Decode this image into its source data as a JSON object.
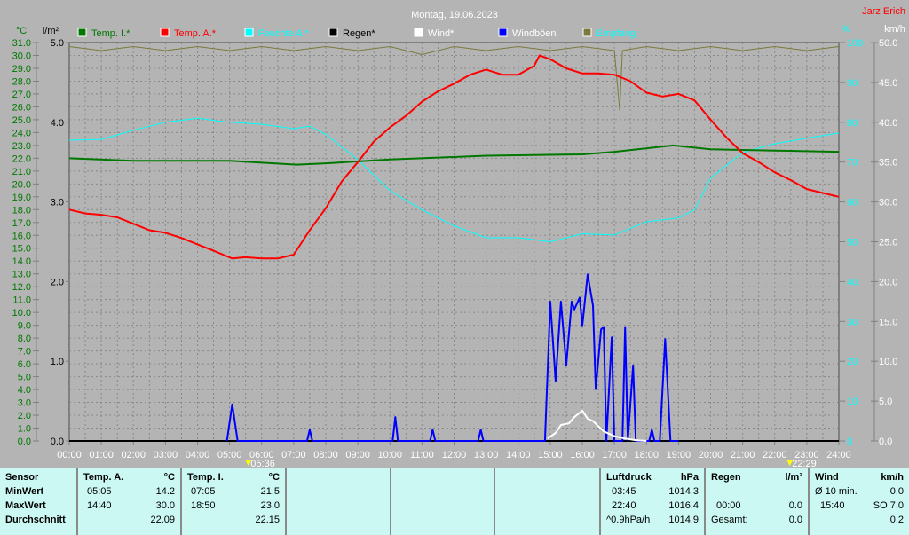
{
  "title": "Montag, 19.06.2023",
  "author": "Jarz Erich",
  "colors": {
    "temp_i": "#007800",
    "temp_a": "#ff0000",
    "humidity": "#00ffff",
    "rain": "#000000",
    "wind": "#ffffff",
    "gusts": "#0000ff",
    "reception": "#7a7a3c"
  },
  "chart_data": {
    "type": "line",
    "title": "Montag, 19.06.2023",
    "axes": {
      "temp": {
        "unit": "°C",
        "range": [
          0,
          31
        ],
        "ticks": [
          "0.0",
          "1.0",
          "2.0",
          "3.0",
          "4.0",
          "5.0",
          "6.0",
          "7.0",
          "8.0",
          "9.0",
          "10.0",
          "11.0",
          "12.0",
          "13.0",
          "14.0",
          "15.0",
          "16.0",
          "17.0",
          "18.0",
          "19.0",
          "20.0",
          "21.0",
          "22.0",
          "23.0",
          "24.0",
          "25.0",
          "26.0",
          "27.0",
          "28.0",
          "29.0",
          "30.0",
          "31.0"
        ]
      },
      "rain": {
        "unit": "l/m²",
        "range": [
          0,
          5
        ],
        "ticks": [
          "0.0",
          "1.0",
          "2.0",
          "3.0",
          "4.0",
          "5.0"
        ]
      },
      "humidity": {
        "unit": "%",
        "range": [
          0,
          100
        ],
        "ticks": [
          "0",
          "10",
          "20",
          "30",
          "40",
          "50",
          "60",
          "70",
          "80",
          "90",
          "100"
        ]
      },
      "wind": {
        "unit": "km/h",
        "range": [
          0,
          50
        ],
        "ticks": [
          "0.0",
          "5.0",
          "10.0",
          "15.0",
          "20.0",
          "25.0",
          "30.0",
          "35.0",
          "40.0",
          "45.0",
          "50.0"
        ]
      },
      "x": {
        "range": [
          "00:00",
          "24:00"
        ],
        "ticks": [
          "00:00",
          "01:00",
          "02:00",
          "03:00",
          "04:00",
          "05:00",
          "06:00",
          "07:00",
          "08:00",
          "09:00",
          "10:00",
          "11:00",
          "12:00",
          "13:00",
          "14:00",
          "15:00",
          "16:00",
          "17:00",
          "18:00",
          "19:00",
          "20:00",
          "21:00",
          "22:00",
          "23:00",
          "24:00"
        ]
      }
    },
    "grid": true,
    "legend_position": "top",
    "legend": [
      {
        "key": "temp_i",
        "label": "Temp. I.*"
      },
      {
        "key": "temp_a",
        "label": "Temp. A.*"
      },
      {
        "key": "humidity",
        "label": "Feuchte A.*"
      },
      {
        "key": "rain",
        "label": "Regen*"
      },
      {
        "key": "wind",
        "label": "Wind*"
      },
      {
        "key": "gusts",
        "label": "Windböen"
      },
      {
        "key": "reception",
        "label": "Empfang"
      }
    ],
    "sun_markers": [
      "05:36",
      "22:29"
    ],
    "series": [
      {
        "key": "temp_a",
        "axis": "temp",
        "points": [
          [
            "00:00",
            18.0
          ],
          [
            "00:30",
            17.7
          ],
          [
            "01:00",
            17.6
          ],
          [
            "01:30",
            17.4
          ],
          [
            "02:00",
            16.9
          ],
          [
            "02:30",
            16.4
          ],
          [
            "03:00",
            16.2
          ],
          [
            "03:30",
            15.8
          ],
          [
            "04:00",
            15.3
          ],
          [
            "04:30",
            14.8
          ],
          [
            "05:05",
            14.2
          ],
          [
            "05:30",
            14.3
          ],
          [
            "06:00",
            14.2
          ],
          [
            "06:30",
            14.2
          ],
          [
            "07:00",
            14.5
          ],
          [
            "07:30",
            16.4
          ],
          [
            "08:00",
            18.1
          ],
          [
            "08:30",
            20.2
          ],
          [
            "09:00",
            21.7
          ],
          [
            "09:30",
            23.3
          ],
          [
            "10:00",
            24.4
          ],
          [
            "10:30",
            25.3
          ],
          [
            "11:00",
            26.4
          ],
          [
            "11:30",
            27.2
          ],
          [
            "12:00",
            27.8
          ],
          [
            "12:30",
            28.5
          ],
          [
            "13:00",
            28.9
          ],
          [
            "13:30",
            28.5
          ],
          [
            "14:00",
            28.5
          ],
          [
            "14:30",
            29.2
          ],
          [
            "14:40",
            30.0
          ],
          [
            "15:00",
            29.7
          ],
          [
            "15:30",
            29.0
          ],
          [
            "16:00",
            28.6
          ],
          [
            "16:30",
            28.6
          ],
          [
            "17:00",
            28.5
          ],
          [
            "17:30",
            28.0
          ],
          [
            "18:00",
            27.1
          ],
          [
            "18:30",
            26.8
          ],
          [
            "19:00",
            27.0
          ],
          [
            "19:30",
            26.5
          ],
          [
            "20:00",
            25.0
          ],
          [
            "20:30",
            23.6
          ],
          [
            "21:00",
            22.4
          ],
          [
            "21:30",
            21.7
          ],
          [
            "22:00",
            20.9
          ],
          [
            "22:30",
            20.3
          ],
          [
            "23:00",
            19.6
          ],
          [
            "23:30",
            19.3
          ],
          [
            "24:00",
            19.0
          ]
        ]
      },
      {
        "key": "temp_i",
        "axis": "temp",
        "points": [
          [
            "00:00",
            22.0
          ],
          [
            "02:00",
            21.8
          ],
          [
            "05:00",
            21.8
          ],
          [
            "07:05",
            21.5
          ],
          [
            "08:00",
            21.6
          ],
          [
            "10:00",
            21.9
          ],
          [
            "13:00",
            22.2
          ],
          [
            "16:00",
            22.3
          ],
          [
            "17:00",
            22.5
          ],
          [
            "18:50",
            23.0
          ],
          [
            "20:00",
            22.7
          ],
          [
            "22:00",
            22.6
          ],
          [
            "24:00",
            22.5
          ]
        ]
      },
      {
        "key": "humidity",
        "axis": "humidity",
        "points": [
          [
            "00:00",
            75.5
          ],
          [
            "01:00",
            75.7
          ],
          [
            "02:00",
            78
          ],
          [
            "03:00",
            80
          ],
          [
            "04:00",
            81
          ],
          [
            "05:00",
            80
          ],
          [
            "06:00",
            79.5
          ],
          [
            "07:00",
            78.4
          ],
          [
            "07:30",
            79
          ],
          [
            "08:00",
            77
          ],
          [
            "09:00",
            70.6
          ],
          [
            "10:00",
            62.8
          ],
          [
            "11:00",
            58
          ],
          [
            "12:00",
            54
          ],
          [
            "13:00",
            51
          ],
          [
            "14:00",
            51
          ],
          [
            "15:00",
            50
          ],
          [
            "16:00",
            52
          ],
          [
            "17:00",
            51.7
          ],
          [
            "18:00",
            55
          ],
          [
            "19:00",
            56
          ],
          [
            "19:30",
            58
          ],
          [
            "20:00",
            66
          ],
          [
            "21:00",
            72.4
          ],
          [
            "22:00",
            74.6
          ],
          [
            "23:00",
            76
          ],
          [
            "24:00",
            77.3
          ]
        ]
      },
      {
        "key": "reception",
        "axis": "humidity",
        "points": [
          [
            "00:00",
            99
          ],
          [
            "01:00",
            98
          ],
          [
            "02:00",
            99
          ],
          [
            "03:00",
            98
          ],
          [
            "04:00",
            99
          ],
          [
            "05:00",
            98
          ],
          [
            "06:00",
            99
          ],
          [
            "07:00",
            98
          ],
          [
            "08:00",
            99
          ],
          [
            "09:00",
            98
          ],
          [
            "10:00",
            99
          ],
          [
            "11:00",
            97
          ],
          [
            "12:00",
            99
          ],
          [
            "13:00",
            98
          ],
          [
            "14:00",
            99
          ],
          [
            "15:00",
            98
          ],
          [
            "16:00",
            99
          ],
          [
            "17:00",
            98
          ],
          [
            "17:10",
            83
          ],
          [
            "17:15",
            98
          ],
          [
            "18:00",
            99
          ],
          [
            "19:00",
            98
          ],
          [
            "20:00",
            99
          ],
          [
            "21:00",
            98
          ],
          [
            "22:00",
            99
          ],
          [
            "23:00",
            98
          ],
          [
            "24:00",
            99
          ]
        ]
      },
      {
        "key": "rain",
        "axis": "rain",
        "points": [
          [
            "00:00",
            0
          ],
          [
            "24:00",
            0
          ]
        ]
      },
      {
        "key": "gusts",
        "axis": "wind",
        "points": [
          [
            "04:55",
            0
          ],
          [
            "05:05",
            4.6
          ],
          [
            "05:15",
            0
          ],
          [
            "07:25",
            0
          ],
          [
            "07:30",
            1.4
          ],
          [
            "07:35",
            0
          ],
          [
            "10:05",
            0
          ],
          [
            "10:10",
            3.0
          ],
          [
            "10:15",
            0
          ],
          [
            "11:15",
            0
          ],
          [
            "11:20",
            1.4
          ],
          [
            "11:25",
            0
          ],
          [
            "12:45",
            0
          ],
          [
            "12:50",
            1.4
          ],
          [
            "12:55",
            0
          ],
          [
            "14:50",
            0
          ],
          [
            "15:00",
            17.5
          ],
          [
            "15:10",
            7.5
          ],
          [
            "15:20",
            17.5
          ],
          [
            "15:30",
            9.5
          ],
          [
            "15:40",
            17.5
          ],
          [
            "15:45",
            16.5
          ],
          [
            "15:55",
            18
          ],
          [
            "16:00",
            14.5
          ],
          [
            "16:10",
            20.9
          ],
          [
            "16:20",
            17
          ],
          [
            "16:25",
            6.5
          ],
          [
            "16:35",
            14
          ],
          [
            "16:40",
            14.3
          ],
          [
            "16:45",
            0
          ],
          [
            "16:55",
            13
          ],
          [
            "17:00",
            0
          ],
          [
            "17:15",
            0
          ],
          [
            "17:20",
            14.3
          ],
          [
            "17:25",
            0
          ],
          [
            "17:35",
            9.5
          ],
          [
            "17:40",
            0
          ],
          [
            "18:05",
            0
          ],
          [
            "18:10",
            1.4
          ],
          [
            "18:15",
            0
          ],
          [
            "18:25",
            0
          ],
          [
            "18:35",
            12.8
          ],
          [
            "18:45",
            0
          ],
          [
            "19:00",
            0
          ]
        ]
      },
      {
        "key": "wind",
        "axis": "wind",
        "points": [
          [
            "14:55",
            0.3
          ],
          [
            "15:10",
            1
          ],
          [
            "15:20",
            2
          ],
          [
            "15:35",
            2.2
          ],
          [
            "15:45",
            3.0
          ],
          [
            "16:00",
            3.8
          ],
          [
            "16:10",
            2.8
          ],
          [
            "16:20",
            2.5
          ],
          [
            "16:40",
            1.2
          ],
          [
            "17:00",
            0.6
          ],
          [
            "17:20",
            0.3
          ],
          [
            "17:40",
            0.1
          ],
          [
            "18:00",
            0.0
          ]
        ]
      }
    ]
  },
  "table": {
    "sensor": {
      "header": "Sensor",
      "rows": [
        "MinWert",
        "MaxWert",
        "Durchschnitt"
      ]
    },
    "temp_a": {
      "header": "Temp. A.",
      "unit": "°C",
      "min_time": "05:05",
      "min": "14.2",
      "max_time": "14:40",
      "max": "30.0",
      "avg": "22.09"
    },
    "temp_i": {
      "header": "Temp. I.",
      "unit": "°C",
      "min_time": "07:05",
      "min": "21.5",
      "max_time": "18:50",
      "max": "23.0",
      "avg": "22.15"
    },
    "pressure": {
      "header": "Luftdruck",
      "unit": "hPa",
      "min_time": "03:45",
      "min": "1014.3",
      "max_time": "22:40",
      "max": "1016.4",
      "trend": "^0.9hPa/h",
      "current": "1014.9"
    },
    "rain": {
      "header": "Regen",
      "unit": "l/m²",
      "max_time": "00:00",
      "max": "0.0",
      "total_label": "Gesamt:",
      "total": "0.0"
    },
    "wind": {
      "header": "Wind",
      "unit": "km/h",
      "avg_label": "Ø 10 min.",
      "avg": "0.0",
      "max_time": "15:40",
      "max": "SO 7.0",
      "current": "0.2"
    }
  }
}
